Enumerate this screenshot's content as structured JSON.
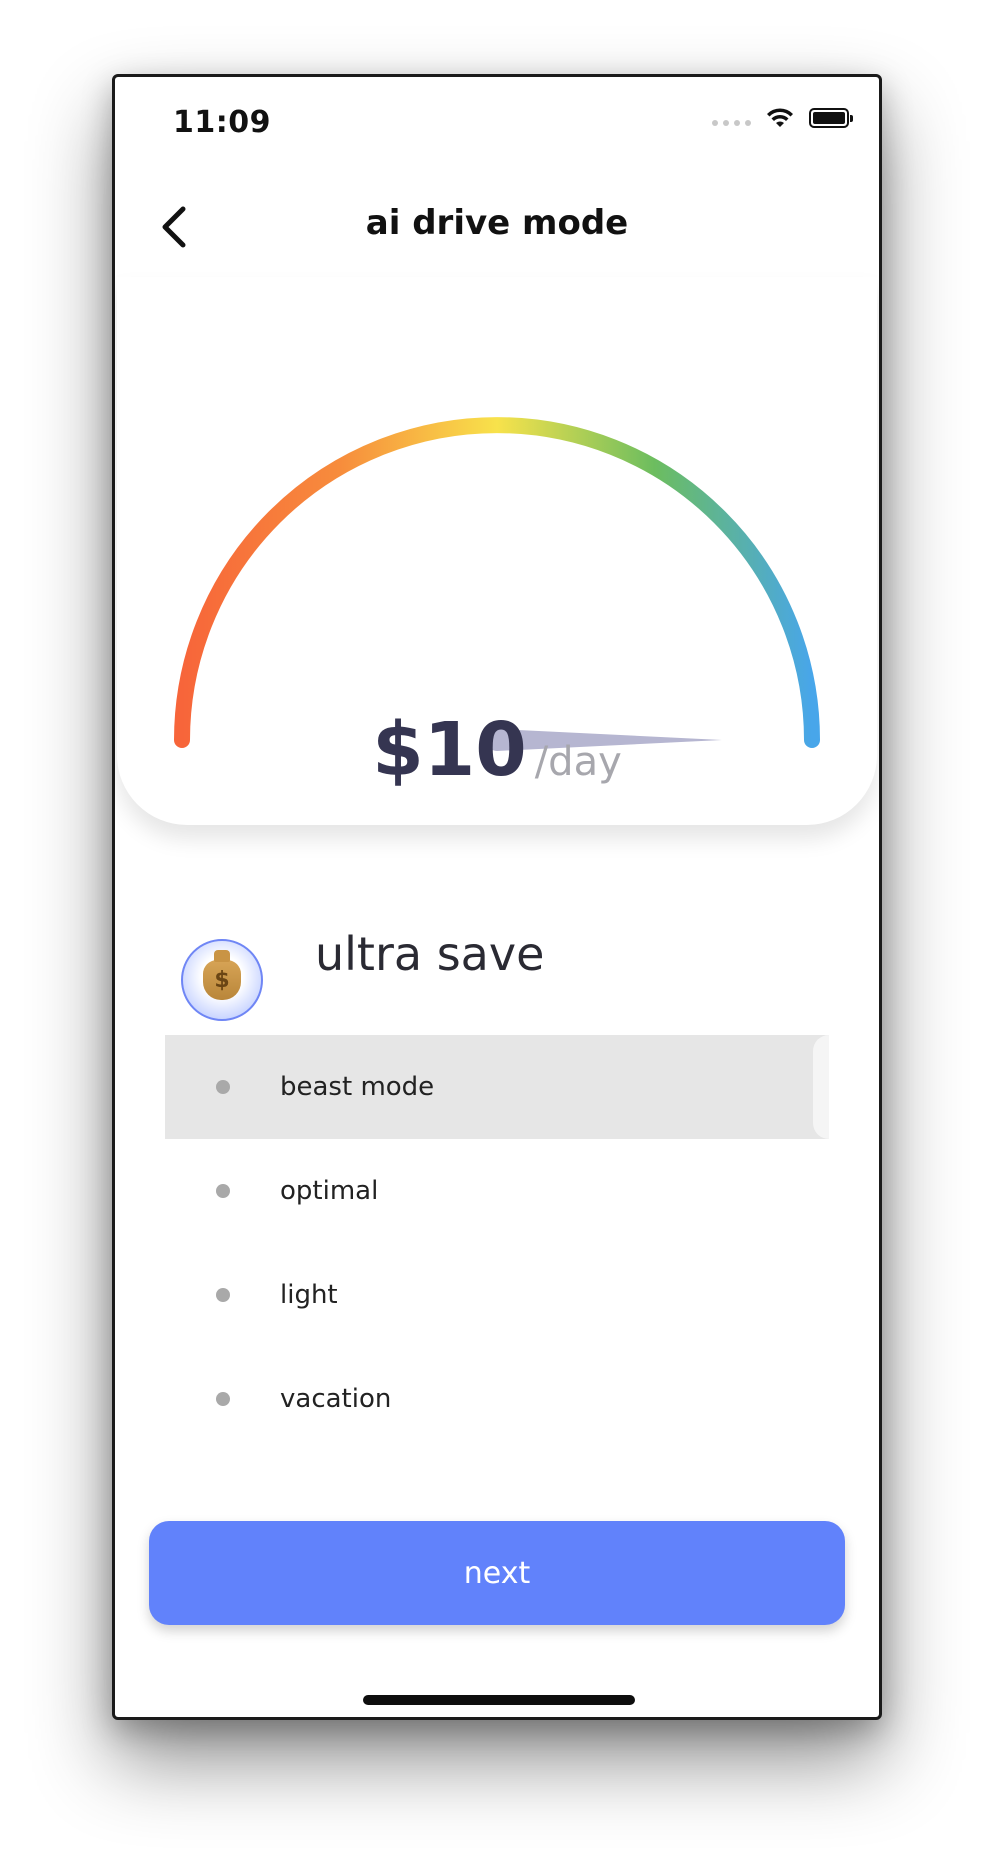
{
  "status_bar": {
    "time": "11:09"
  },
  "header": {
    "title": "ai drive mode"
  },
  "gauge": {
    "gradient_colors": [
      "#f7653a",
      "#f78c3c",
      "#f8e24b",
      "#6cbd5f",
      "#48a6ea"
    ],
    "needle_color": "#b6b6d1",
    "price": "$10",
    "unit": "/day"
  },
  "plan": {
    "icon": "money-bag-icon",
    "title": "ultra save"
  },
  "modes": [
    {
      "label": "beast mode",
      "selected": true
    },
    {
      "label": "optimal",
      "selected": false
    },
    {
      "label": "light",
      "selected": false
    },
    {
      "label": "vacation",
      "selected": false
    }
  ],
  "footer": {
    "next_label": "next"
  },
  "colors": {
    "accent": "#6182fb",
    "title_text": "#353551",
    "muted": "#a7a7ad"
  }
}
